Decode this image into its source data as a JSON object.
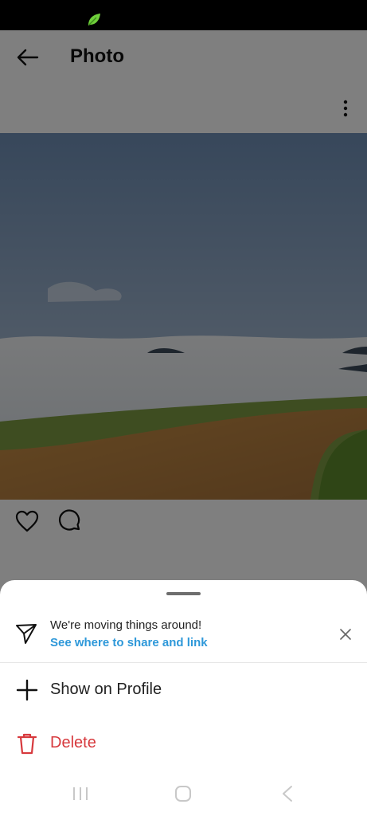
{
  "status_bar": {
    "icon": "leaf-icon",
    "icon_color": "#6fcf3b"
  },
  "header": {
    "title": "Photo",
    "back_icon": "arrow-left-icon",
    "more_icon": "more-vertical-icon"
  },
  "post": {
    "actions": [
      "heart-icon",
      "comment-icon"
    ]
  },
  "sheet": {
    "notice": {
      "title": "We're moving things around!",
      "link": "See where to share and link",
      "icon": "send-icon",
      "close_icon": "close-icon",
      "link_color": "#2e98d9"
    },
    "options": [
      {
        "label": "Show on Profile",
        "icon": "plus-icon"
      },
      {
        "label": "Delete",
        "icon": "trash-icon",
        "color": "#d7393d"
      }
    ]
  },
  "nav_bar": {
    "buttons": [
      "recents-icon",
      "home-icon",
      "back-icon"
    ]
  }
}
